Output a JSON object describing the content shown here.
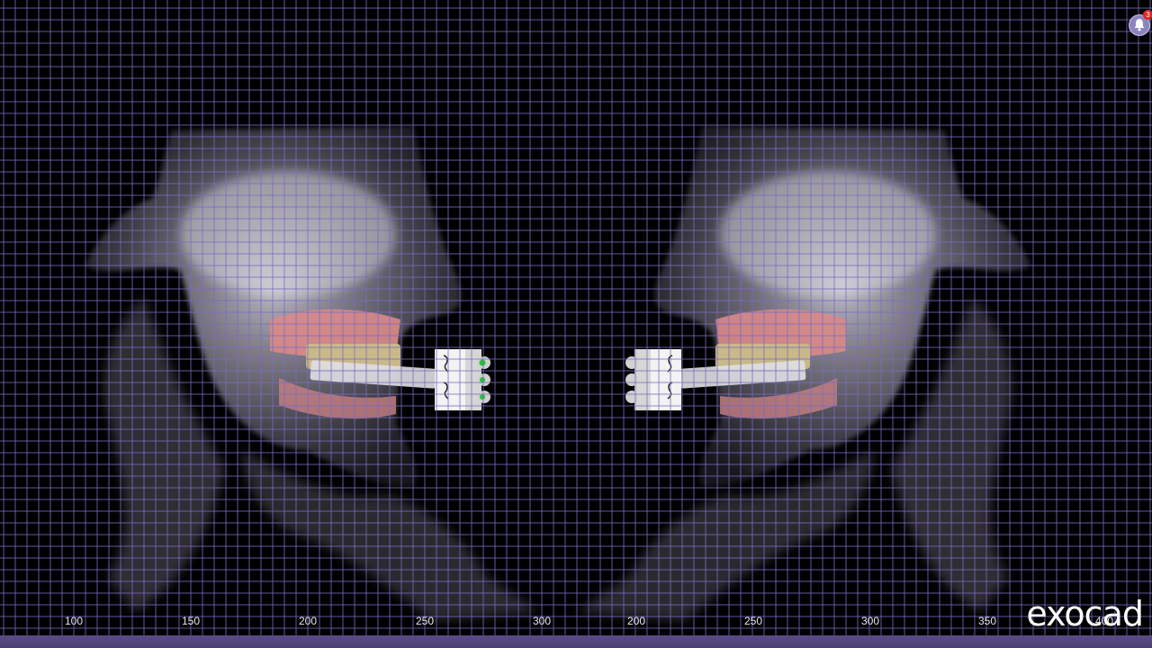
{
  "app": {
    "brand": "exocad"
  },
  "notifications": {
    "count": "3",
    "icon": "bell-icon"
  },
  "ruler": {
    "labels": [
      "100",
      "150",
      "200",
      "250",
      "300",
      "200",
      "250",
      "300",
      "350",
      "400"
    ]
  },
  "colors": {
    "grid": "#7b6cc0",
    "background": "#000000",
    "bottom_bar": "#4f4379",
    "scan_tissue": "#b9b5c6",
    "gingiva": "#d98a8a",
    "marker_green": "#22c432"
  }
}
